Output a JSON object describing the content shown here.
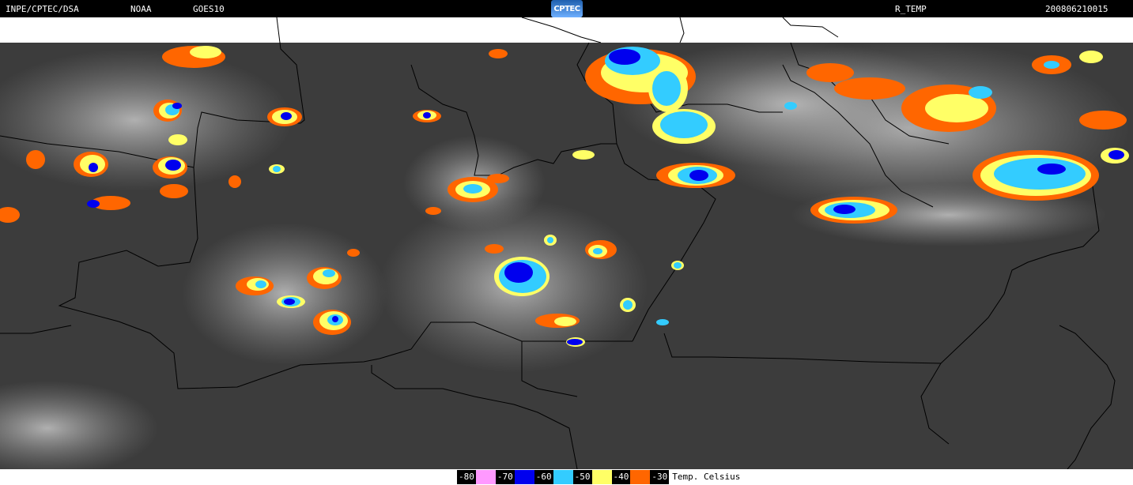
{
  "header": {
    "source": "INPE/CPTEC/DSA",
    "agency": "NOAA",
    "satellite": "GOES10",
    "logo_text": "CPTEC",
    "product": "R_TEMP",
    "timestamp": "200806210015"
  },
  "legend": {
    "title": "Temp. Celsius",
    "classes": [
      {
        "label": "-80",
        "color": "#ff99ff"
      },
      {
        "label": "-70",
        "color": "#0000ee"
      },
      {
        "label": "-60",
        "color": "#33ccff"
      },
      {
        "label": "-50",
        "color": "#ffff66"
      },
      {
        "label": "-40",
        "color": "#ff6600"
      },
      {
        "label": "-30",
        "color": ""
      }
    ]
  },
  "colors": {
    "background_ir": "#3c3c3c",
    "coast_land": "#8a8a8a",
    "borders": "#000000",
    "cold_top_very": "#0000ee",
    "cold_top": "#33ccff",
    "mid_top": "#ffff66",
    "warm_top": "#ff6600"
  }
}
